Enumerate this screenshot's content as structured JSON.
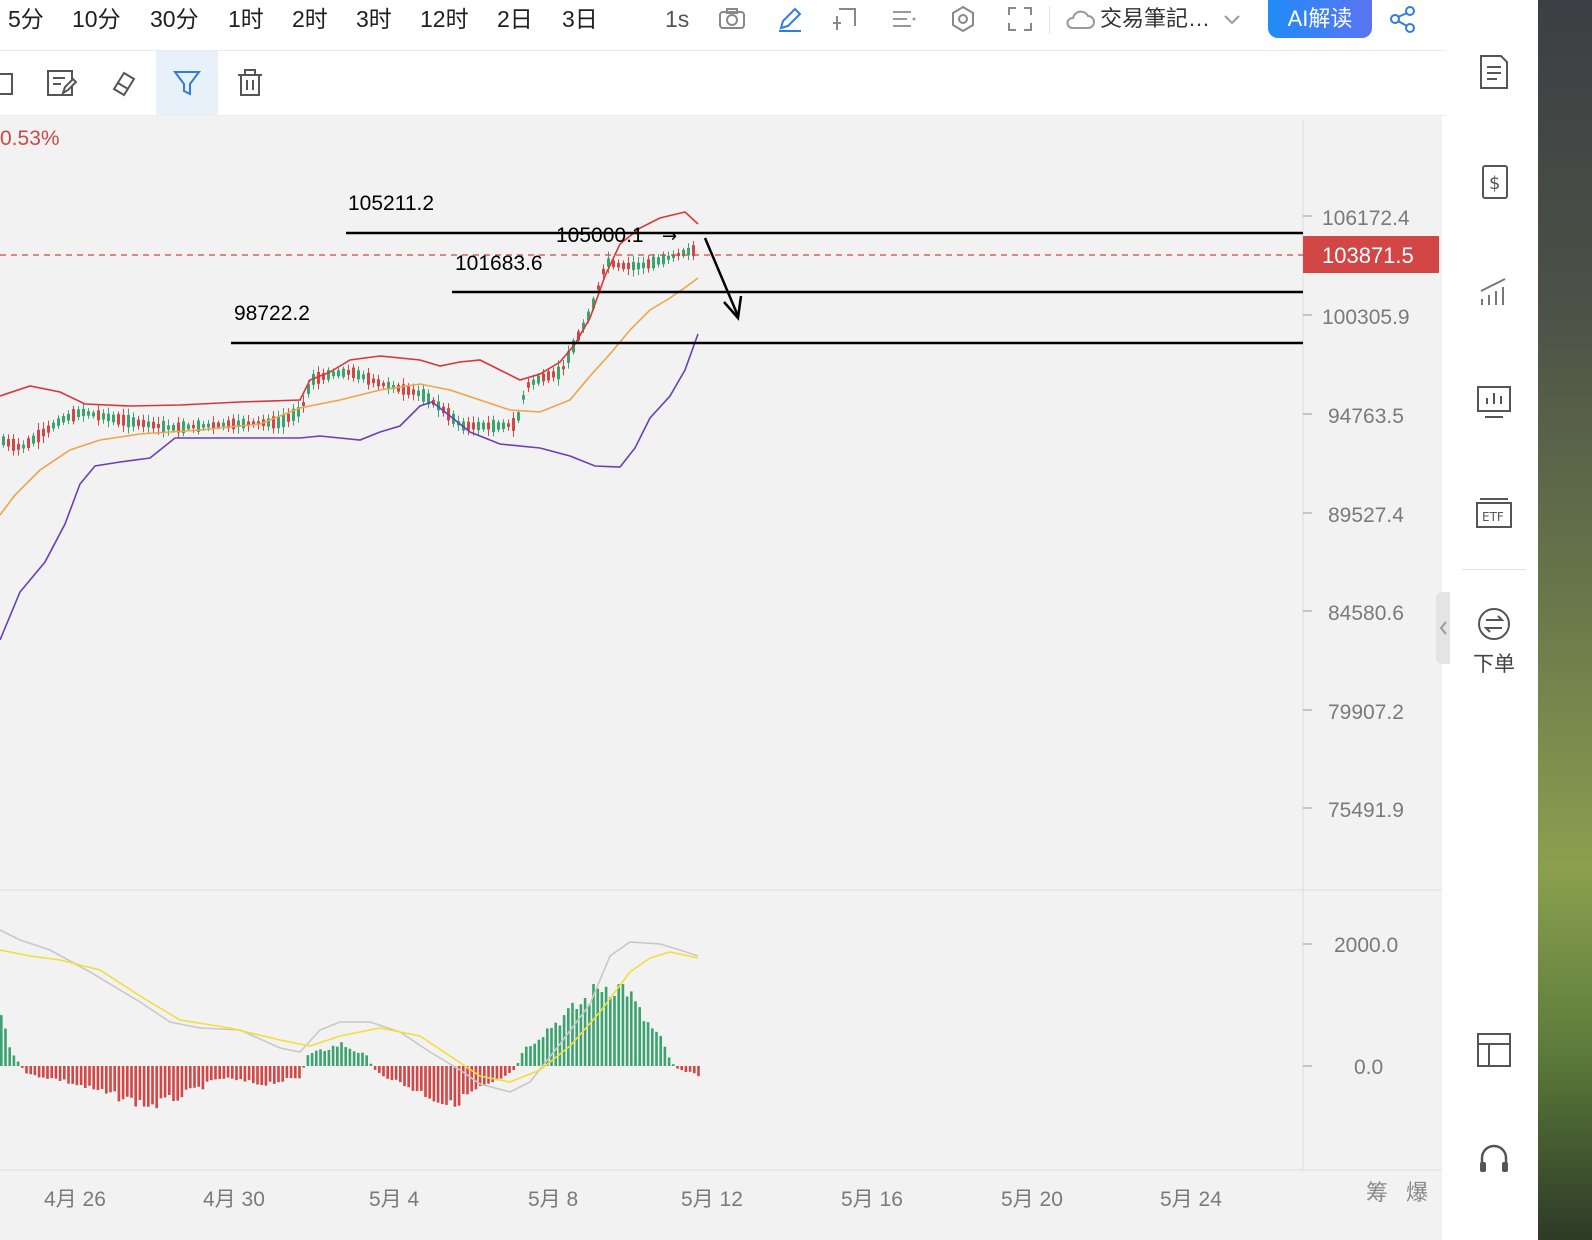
{
  "timeframes": [
    "5分",
    "10分",
    "30分",
    "1时",
    "2时",
    "3时",
    "12时",
    "2日",
    "3日"
  ],
  "interval_label": "1s",
  "notes_label": "交易筆記…",
  "ai_label": "AI解读",
  "pct_label": "0.53%",
  "price_axis": [
    "106172.4",
    "100305.9",
    "94763.5",
    "89527.4",
    "84580.6",
    "79907.2",
    "75491.9"
  ],
  "current_price": "103871.5",
  "osc_axis": [
    "2000.0",
    "0.0"
  ],
  "date_axis": [
    "4月 26",
    "4月 30",
    "5月 4",
    "5月 8",
    "5月 12",
    "5月 16",
    "5月 20",
    "5月 24"
  ],
  "bottom_right_labels": [
    "筹",
    "爆"
  ],
  "annotations": {
    "level_1": "105211.2",
    "level_1_mark": "105000.1",
    "level_2": "101683.6",
    "level_3": "98722.2"
  },
  "sidebar": {
    "order_label": "下单"
  },
  "colors": {
    "up": "#3aa36e",
    "down": "#d24646",
    "boll_upper": "#d7373a",
    "boll_mid": "#f0a34a",
    "boll_lower": "#6a3fb8",
    "dif": "#c8c8c8",
    "dea": "#f2de3b",
    "accent": "#2f7de1"
  }
}
